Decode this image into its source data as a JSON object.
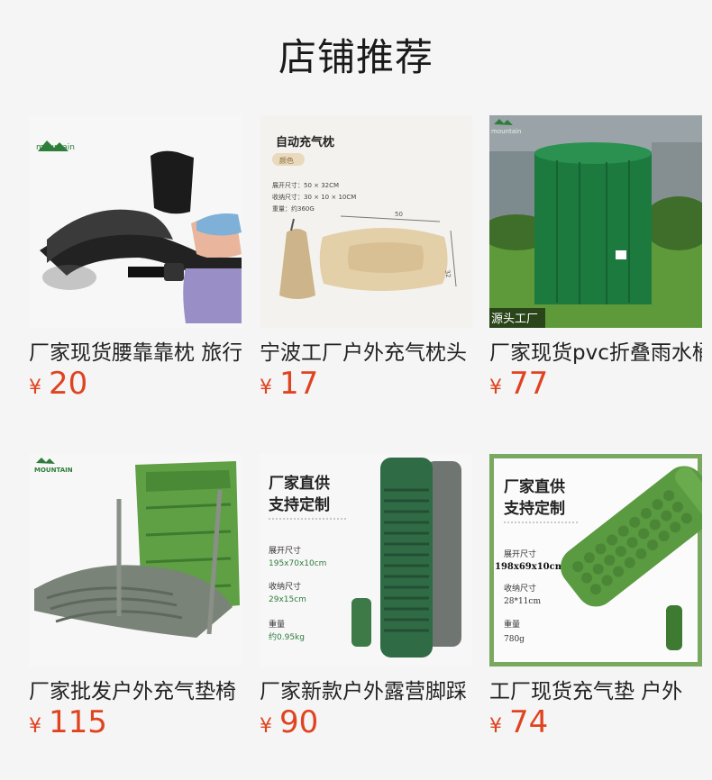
{
  "page": {
    "title": "店铺推荐"
  },
  "currency": "¥",
  "products": [
    {
      "name": "厂家现货腰靠靠枕 旅行",
      "price": "20",
      "image": {
        "logo": "mountain"
      }
    },
    {
      "name": "宁波工厂户外充气枕头",
      "price": "17",
      "image": {
        "heading": "自动充气枕",
        "tag": "颜色",
        "specs": [
          "展开尺寸：50 × 32CM",
          "收纳尺寸：30 × 10 × 10CM",
          "重量：约360G"
        ],
        "dim_w": "50",
        "dim_h": "32"
      }
    },
    {
      "name": "厂家现货pvc折叠雨水桶",
      "price": "77",
      "image": {
        "logo": "mountain",
        "caption": "源头工厂"
      }
    },
    {
      "name": "厂家批发户外充气垫椅",
      "price": "115",
      "image": {
        "logo": "MOUNTAIN"
      }
    },
    {
      "name": "厂家新款户外露营脚踩",
      "price": "90",
      "image": {
        "headline": [
          "厂家直供",
          "支持定制"
        ],
        "spec_labels": [
          "展开尺寸",
          "收纳尺寸",
          "重量"
        ],
        "spec_values": [
          "195x70x10cm",
          "29x15cm",
          "约0.95kg"
        ]
      }
    },
    {
      "name": "工厂现货充气垫 户外",
      "price": "74",
      "image": {
        "headline": [
          "厂家直供",
          "支持定制"
        ],
        "spec_labels": [
          "展开尺寸",
          "收纳尺寸",
          "重量"
        ],
        "spec_values": [
          "198x69x10cm",
          "28*11cm",
          "780g"
        ]
      }
    }
  ]
}
